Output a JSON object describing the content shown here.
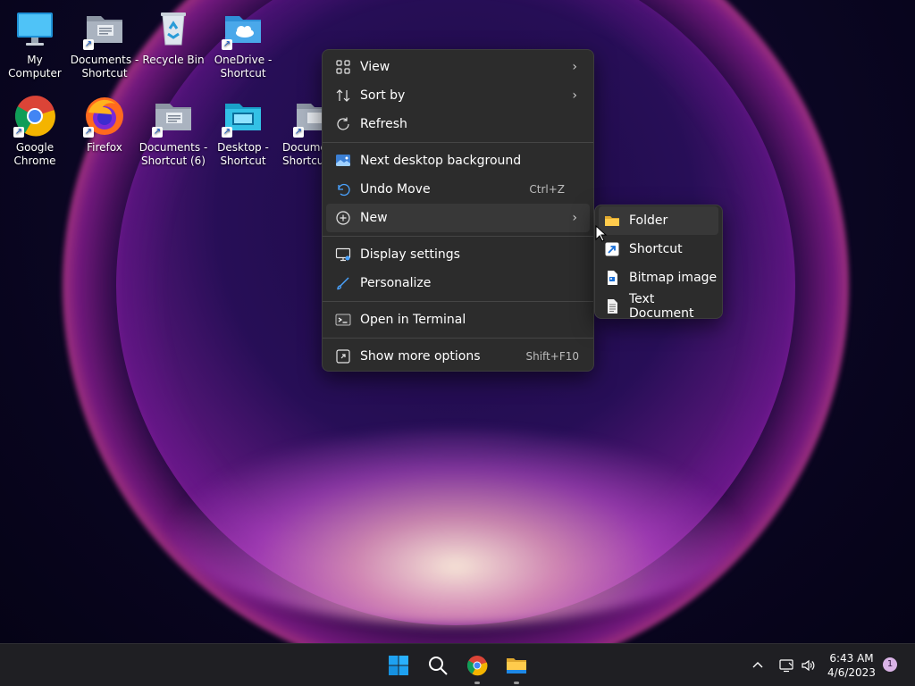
{
  "desktop_icons": [
    {
      "label": "My Computer",
      "icon": "monitor-icon",
      "shortcut": false
    },
    {
      "label": "Documents - Shortcut",
      "icon": "folder-documents-icon",
      "shortcut": true
    },
    {
      "label": "Recycle Bin",
      "icon": "recycle-bin-icon",
      "shortcut": false
    },
    {
      "label": "OneDrive - Shortcut",
      "icon": "onedrive-folder-icon",
      "shortcut": true
    },
    {
      "label": "Google Chrome",
      "icon": "chrome-icon",
      "shortcut": true
    },
    {
      "label": "Firefox",
      "icon": "firefox-icon",
      "shortcut": true
    },
    {
      "label": "Documents - Shortcut (6)",
      "icon": "folder-documents-icon",
      "shortcut": true
    },
    {
      "label": "Desktop - Shortcut",
      "icon": "desktop-folder-icon",
      "shortcut": true
    },
    {
      "label": "Docume Shortcu",
      "icon": "folder-documents-icon",
      "shortcut": true
    }
  ],
  "context_menu": {
    "items": [
      {
        "label": "View",
        "icon": "view-grid-icon",
        "submenu": true
      },
      {
        "label": "Sort by",
        "icon": "sort-icon",
        "submenu": true
      },
      {
        "label": "Refresh",
        "icon": "refresh-icon"
      },
      {
        "label": "Next desktop background",
        "icon": "next-background-icon"
      },
      {
        "label": "Undo Move",
        "icon": "undo-icon",
        "shortcut": "Ctrl+Z"
      },
      {
        "label": "New",
        "icon": "new-plus-icon",
        "submenu": true
      },
      {
        "label": "Display settings",
        "icon": "display-settings-icon"
      },
      {
        "label": "Personalize",
        "icon": "personalize-brush-icon"
      },
      {
        "label": "Open in Terminal",
        "icon": "terminal-icon"
      },
      {
        "label": "Show more options",
        "icon": "more-options-icon",
        "shortcut": "Shift+F10"
      }
    ]
  },
  "new_submenu": {
    "items": [
      {
        "label": "Folder",
        "icon": "folder-icon"
      },
      {
        "label": "Shortcut",
        "icon": "shortcut-icon"
      },
      {
        "label": "Bitmap image",
        "icon": "bitmap-image-icon"
      },
      {
        "label": "Text Document",
        "icon": "text-document-icon"
      }
    ]
  },
  "taskbar": {
    "apps": [
      "start-icon",
      "search-icon",
      "chrome-icon",
      "file-explorer-icon"
    ],
    "clock": {
      "time": "6:43 AM",
      "date": "4/6/2023"
    },
    "notification_count": "1"
  },
  "colors": {
    "menu_bg": "#2c2c2c",
    "menu_hover": "#383838",
    "taskbar_bg": "#1f1f23",
    "accent_blue": "#0078d4"
  }
}
